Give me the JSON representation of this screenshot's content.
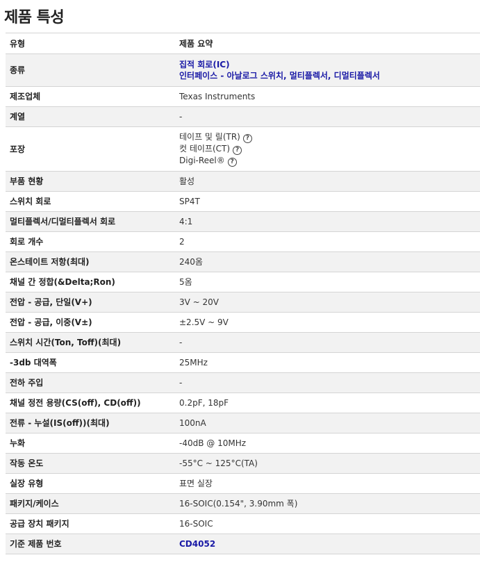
{
  "page_title": "제품 특성",
  "header": {
    "type_label": "유형",
    "summary_label": "제품 요약"
  },
  "rows": {
    "category": {
      "label": "종류",
      "links": [
        "집적 회로(IC)",
        "인터페이스 - 아날로그 스위치, 멀티플렉서, 디멀티플렉서"
      ]
    },
    "manufacturer": {
      "label": "제조업체",
      "value": "Texas Instruments"
    },
    "series": {
      "label": "계열",
      "value": "-"
    },
    "packaging": {
      "label": "포장",
      "options": [
        "테이프 및 릴(TR)",
        "컷 테이프(CT)",
        "Digi-Reel®"
      ],
      "help_icon": "question-circle-icon",
      "help_glyph": "?"
    },
    "part_status": {
      "label": "부품 현황",
      "value": "활성"
    },
    "switch_circuit": {
      "label": "스위치 회로",
      "value": "SP4T"
    },
    "mux_circuit": {
      "label": "멀티플렉서/디멀티플렉서 회로",
      "value": "4:1"
    },
    "circuit_count": {
      "label": "회로 개수",
      "value": "2"
    },
    "on_resistance": {
      "label": "온스테이트 저항(최대)",
      "value": "240옴"
    },
    "channel_matching": {
      "label": "채널 간 정합(&Delta;Ron)",
      "value": "5옴"
    },
    "voltage_single": {
      "label": "전압 - 공급, 단일(V+)",
      "value": "3V ~ 20V"
    },
    "voltage_dual": {
      "label": "전압 - 공급, 이중(V±)",
      "value": "±2.5V ~ 9V"
    },
    "switch_time": {
      "label": "스위치 시간(Ton, Toff)(최대)",
      "value": "-"
    },
    "bandwidth": {
      "label": "-3db 대역폭",
      "value": "25MHz"
    },
    "charge_injection": {
      "label": "전하 주입",
      "value": "-"
    },
    "channel_capacitance": {
      "label": "채널 정전 용량(CS(off), CD(off))",
      "value": "0.2pF, 18pF"
    },
    "leakage_current": {
      "label": "전류 - 누설(IS(off))(최대)",
      "value": "100nA"
    },
    "crosstalk": {
      "label": "누화",
      "value": "-40dB @ 10MHz"
    },
    "operating_temp": {
      "label": "작동 온도",
      "value": "-55°C ~ 125°C(TA)"
    },
    "mounting_type": {
      "label": "실장 유형",
      "value": "표면 실장"
    },
    "package_case": {
      "label": "패키지/케이스",
      "value": "16-SOIC(0.154\", 3.90mm 폭)"
    },
    "supplier_package": {
      "label": "공급 장치 패키지",
      "value": "16-SOIC"
    },
    "base_part_number": {
      "label": "기준 제품 번호",
      "value": "CD4052"
    }
  },
  "colors": {
    "link": "#1a1aa6",
    "stripe": "#f2f2f2",
    "border": "#d4d4d4"
  }
}
